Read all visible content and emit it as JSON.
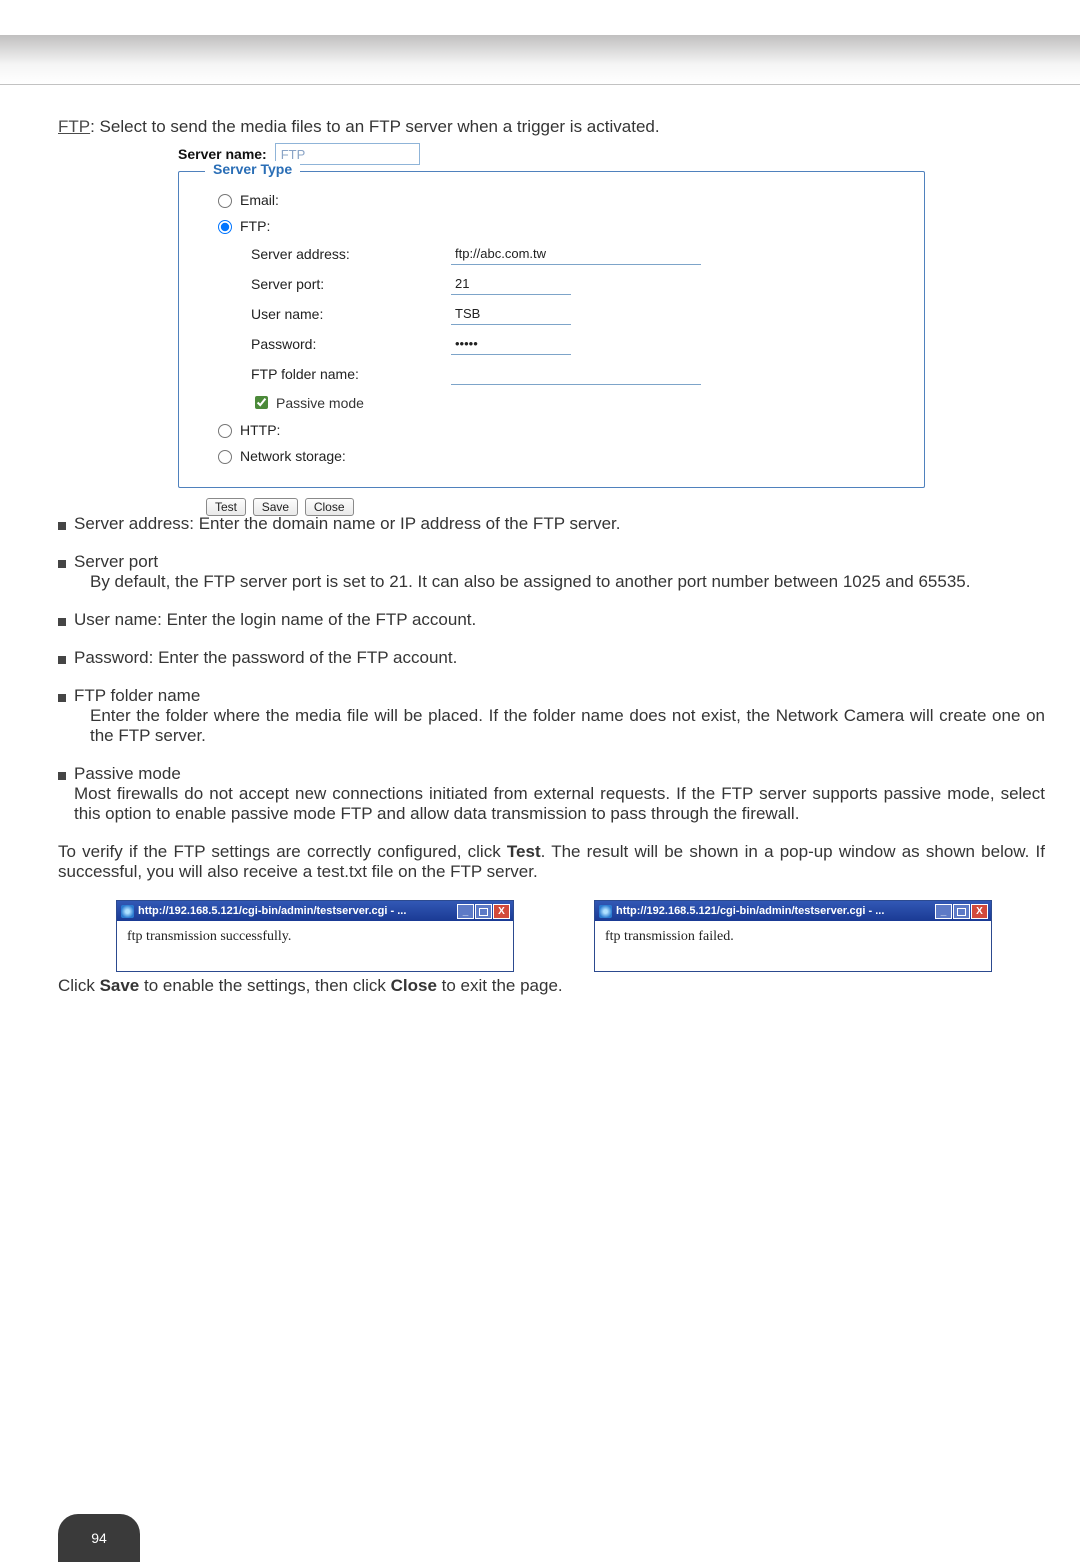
{
  "intro": {
    "ftp_label": "FTP",
    "text_after": ": Select to send the media files to an FTP server when a trigger is activated."
  },
  "config": {
    "server_name_label": "Server name:",
    "server_name_value": "FTP",
    "fieldset_legend": "Server Type",
    "options": {
      "email": "Email:",
      "ftp": "FTP:",
      "http": "HTTP:",
      "network_storage": "Network storage:"
    },
    "ftp_fields": {
      "server_address": {
        "label": "Server address:",
        "value": "ftp://abc.com.tw"
      },
      "server_port": {
        "label": "Server port:",
        "value": "21"
      },
      "user_name": {
        "label": "User name:",
        "value": "TSB"
      },
      "password": {
        "label": "Password:",
        "value": "•••••"
      },
      "folder_name": {
        "label": "FTP folder name:",
        "value": ""
      },
      "passive_mode": {
        "label": "Passive mode",
        "checked": true
      }
    },
    "buttons": {
      "test": "Test",
      "save": "Save",
      "close": "Close"
    }
  },
  "bullets": {
    "server_address": "Server address: Enter the domain name or IP address of the FTP server.",
    "server_port_title": "Server port",
    "server_port_desc": "By default, the FTP server port is set to 21. It can also be assigned to another port number between 1025 and 65535.",
    "user_name": "User name: Enter the login name of the FTP account.",
    "password": "Password: Enter the password of the FTP account.",
    "ftp_folder_title": "FTP folder name",
    "ftp_folder_desc": "Enter the folder where the media file will be placed. If the folder name does not exist, the Network Camera will create one on the FTP server.",
    "passive_title": "Passive mode",
    "passive_desc": "Most firewalls do not accept new connections initiated from external requests. If the FTP server supports passive mode, select this option to enable passive mode FTP and allow data transmission to pass through the firewall."
  },
  "test_para_1": "To verify if the FTP settings are correctly configured, click ",
  "test_word": "Test",
  "test_para_2": ". The result will be shown in a pop-up window as shown below. If successful, you will also receive a test.txt file on the FTP server.",
  "popup_title": "http://192.168.5.121/cgi-bin/admin/testserver.cgi - ...",
  "popup_success": "ftp transmission successfully.",
  "popup_failed": "ftp transmission failed.",
  "closing_1": "Click ",
  "closing_save": "Save",
  "closing_2": " to enable the settings, then click ",
  "closing_close": "Close",
  "closing_3": " to exit the page.",
  "page_number": "94"
}
